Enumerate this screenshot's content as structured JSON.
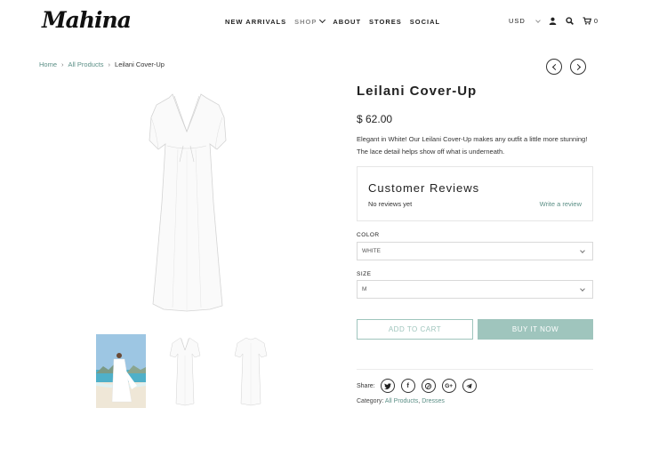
{
  "header": {
    "logo": "Mahina",
    "nav": [
      {
        "label": "NEW ARRIVALS",
        "muted": false
      },
      {
        "label": "SHOP",
        "muted": true
      },
      {
        "label": "ABOUT",
        "muted": false
      },
      {
        "label": "STORES",
        "muted": false
      },
      {
        "label": "SOCIAL",
        "muted": false
      }
    ],
    "currency": "USD",
    "cart_count": "0",
    "icons": [
      "user-icon",
      "search-icon",
      "cart-icon"
    ]
  },
  "breadcrumb": {
    "home": "Home",
    "collection": "All Products",
    "current": "Leilani Cover-Up"
  },
  "product": {
    "title": "Leilani Cover-Up",
    "price": "$ 62.00",
    "description": "Elegant in White! Our Leilani Cover-Up makes any outfit a little more stunning! The lace detail helps show off what is underneath.",
    "reviews": {
      "heading": "Customer Reviews",
      "none_text": "No reviews yet",
      "write_link": "Write a review"
    },
    "options": {
      "color_label": "COLOR",
      "color_value": "WHITE",
      "size_label": "SIZE",
      "size_value": "M"
    },
    "add_to_cart": "ADD TO CART",
    "buy_now": "BUY IT NOW",
    "share_label": "Share:",
    "share_icons": [
      "twitter-icon",
      "facebook-icon",
      "pinterest-icon",
      "google-plus-icon",
      "telegram-icon"
    ],
    "category_label": "Category:",
    "categories": [
      "All Products",
      "Dresses"
    ]
  },
  "colors": {
    "accent": "#9fc5bd",
    "link": "#5b8f86"
  }
}
